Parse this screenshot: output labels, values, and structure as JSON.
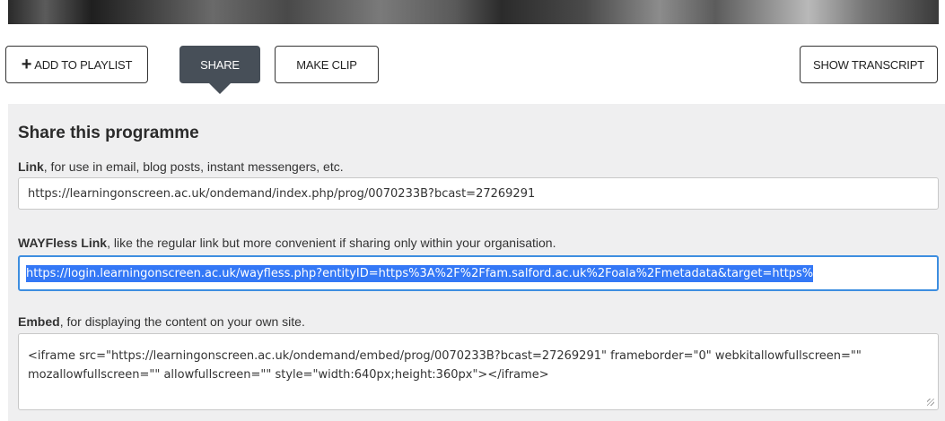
{
  "toolbar": {
    "add_to_playlist_label": "ADD TO PLAYLIST",
    "share_label": "SHARE",
    "make_clip_label": "MAKE CLIP",
    "show_transcript_label": "SHOW TRANSCRIPT",
    "share_active_color": "#474f58"
  },
  "share_panel": {
    "title": "Share this programme",
    "link": {
      "label_bold": "Link",
      "label_rest": ", for use in email, blog posts, instant messengers, etc.",
      "value": "https://learningonscreen.ac.uk/ondemand/index.php/prog/0070233B?bcast=27269291"
    },
    "wayfless": {
      "label_bold": "WAYFless Link",
      "label_rest": ", like the regular link but more convenient if sharing only within your organisation.",
      "value": "https://login.learningonscreen.ac.uk/wayfless.php?entityID=https%3A%2F%2Ffam.salford.ac.uk%2Foala%2Fmetadata&target=https%",
      "selected": true,
      "focus_color": "#3d8ee0"
    },
    "embed": {
      "label_bold": "Embed",
      "label_rest": ", for displaying the content on your own site.",
      "value": "<iframe src=\"https://learningonscreen.ac.uk/ondemand/embed/prog/0070233B?bcast=27269291\" frameborder=\"0\" webkitallowfullscreen=\"\" mozallowfullscreen=\"\" allowfullscreen=\"\" style=\"width:640px;height:360px\"></iframe>"
    }
  }
}
